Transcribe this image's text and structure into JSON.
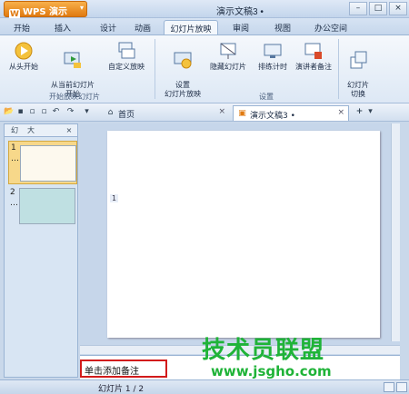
{
  "app": {
    "name": "WPS 演示",
    "doc_title": "演示文稿3 •"
  },
  "window_controls": [
    "–",
    "□",
    "×"
  ],
  "ribbon_tabs": [
    "开始",
    "插入",
    "设计",
    "动画",
    "幻灯片放映",
    "审阅",
    "视图",
    "办公空间"
  ],
  "active_tab_index": 4,
  "ribbon": {
    "buttons": [
      {
        "label": "从头开始",
        "icon": "play-icon"
      },
      {
        "label": "从当前幻灯片\n开始",
        "icon": "play-current-icon"
      },
      {
        "label": "自定义放映",
        "icon": "custom-show-icon"
      },
      {
        "label": "设置\n幻灯片放映",
        "icon": "setup-show-icon"
      },
      {
        "label": "隐藏幻灯片",
        "icon": "hide-slide-icon"
      },
      {
        "label": "排练计时",
        "icon": "rehearse-timing-icon"
      },
      {
        "label": "演讲者备注",
        "icon": "speaker-notes-icon"
      },
      {
        "label": "幻灯片\n切换",
        "icon": "slide-transition-icon"
      }
    ],
    "groups": [
      "开始放映幻灯片",
      "设置"
    ]
  },
  "doc_tabs": [
    {
      "label": "首页",
      "active": false
    },
    {
      "label": "演示文稿3 •",
      "active": true
    }
  ],
  "left_pane": {
    "tabs": [
      "幻",
      "大"
    ],
    "thumbnails": [
      {
        "num": "1",
        "sub": "…",
        "fill": "#fdf9ee"
      },
      {
        "num": "2",
        "sub": "…",
        "fill": "#bfe0e2"
      }
    ]
  },
  "canvas": {
    "slide_number_tag": "1"
  },
  "notes": {
    "placeholder": "单击添加备注"
  },
  "status": {
    "text": "幻灯片 1 / 2"
  },
  "watermark": {
    "cn": "技术员联盟",
    "url": "www.jsgho.com"
  }
}
